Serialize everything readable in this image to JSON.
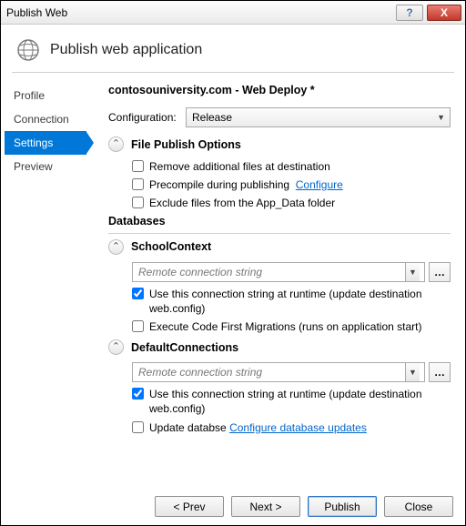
{
  "window": {
    "title": "Publish Web",
    "help": "?",
    "close": "X"
  },
  "header": {
    "title": "Publish web application"
  },
  "sidebar": {
    "items": [
      {
        "label": "Profile",
        "active": false
      },
      {
        "label": "Connection",
        "active": false
      },
      {
        "label": "Settings",
        "active": true
      },
      {
        "label": "Preview",
        "active": false
      }
    ]
  },
  "main": {
    "profile_title": "contosouniversity.com - Web Deploy *",
    "config_label": "Configuration:",
    "config_value": "Release",
    "sections": {
      "file_publish": {
        "title": "File Publish Options",
        "opts": [
          {
            "label": "Remove additional files at destination",
            "checked": false
          },
          {
            "label": "Precompile during publishing",
            "checked": false,
            "link": "Configure"
          },
          {
            "label": "Exclude files from the App_Data folder",
            "checked": false
          }
        ]
      },
      "databases": {
        "title": "Databases",
        "items": [
          {
            "name": "SchoolContext",
            "placeholder": "Remote connection string",
            "opts": [
              {
                "label": "Use this connection string at runtime (update destination web.config)",
                "checked": true
              },
              {
                "label": "Execute Code First Migrations (runs on application start)",
                "checked": false
              }
            ]
          },
          {
            "name": "DefaultConnections",
            "placeholder": "Remote connection string",
            "opts": [
              {
                "label": "Use this connection string at runtime (update destination web.config)",
                "checked": true
              },
              {
                "label": "Update databse",
                "checked": false,
                "link": "Configure database updates"
              }
            ]
          }
        ]
      }
    }
  },
  "footer": {
    "prev": "< Prev",
    "next": "Next >",
    "publish": "Publish",
    "close": "Close"
  }
}
